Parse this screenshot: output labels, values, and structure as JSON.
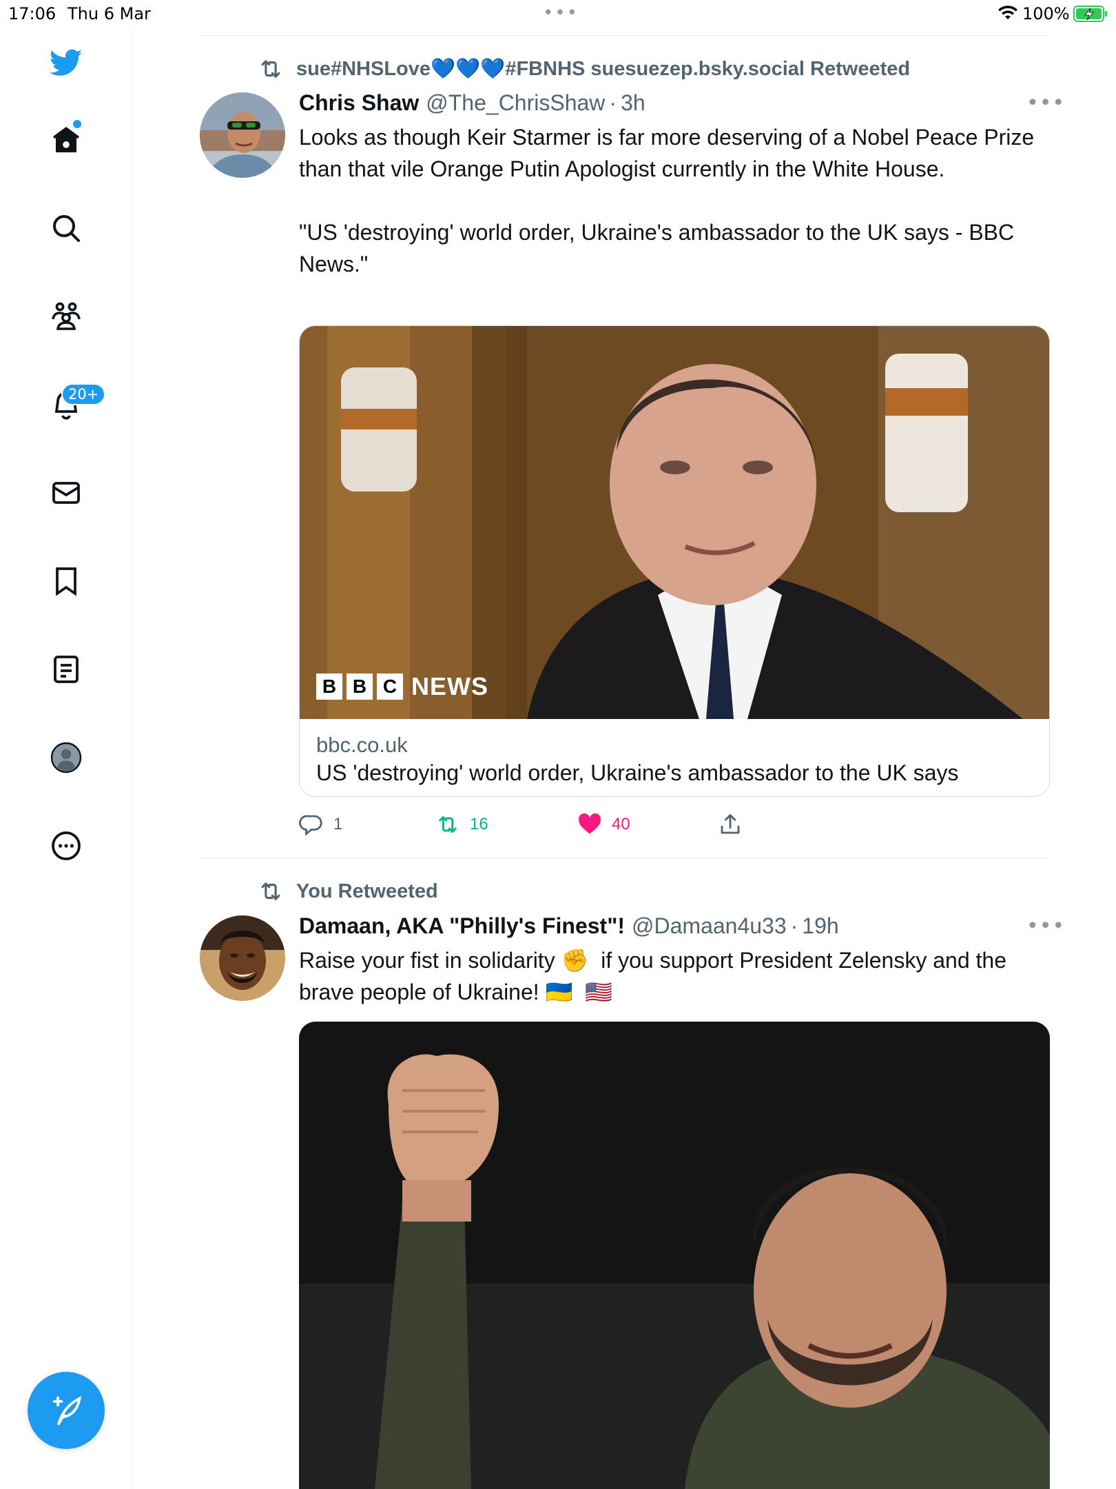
{
  "status_bar": {
    "time": "17:06",
    "date": "Thu 6 Mar",
    "battery": "100%",
    "icons": [
      "wifi-icon",
      "battery-charging-icon"
    ]
  },
  "sidebar": {
    "items": [
      {
        "name": "twitter-logo-icon"
      },
      {
        "name": "home-icon"
      },
      {
        "name": "search-icon"
      },
      {
        "name": "communities-icon"
      },
      {
        "name": "notifications-icon",
        "badge": "20+"
      },
      {
        "name": "messages-icon"
      },
      {
        "name": "bookmarks-icon"
      },
      {
        "name": "lists-icon"
      },
      {
        "name": "profile-icon"
      },
      {
        "name": "more-icon"
      }
    ],
    "compose_icon": "compose-tweet-icon"
  },
  "colors": {
    "accent": "#1d9bf0",
    "retweet_green": "#00ba7c",
    "like_pink": "#f91880",
    "secondary_text": "#536471"
  },
  "tweets": [
    {
      "retweet_context": "sue#NHSLove💙💙💙#FBNHS suesuezep.bsky.social Retweeted",
      "author_name": "Chris Shaw",
      "handle": "@The_ChrisShaw",
      "separator": "·",
      "time": "3h",
      "more": "•••",
      "text": "Looks as though Keir Starmer is far more deserving of a Nobel Peace Prize than that vile Orange Putin Apologist currently in the White House.\n\n\"US 'destroying' world order, Ukraine's ambassador to the UK says - BBC News.\"",
      "card": {
        "logo_letters": [
          "B",
          "B",
          "C"
        ],
        "logo_word": "NEWS",
        "domain": "bbc.co.uk",
        "title": "US 'destroying' world order, Ukraine's ambassador to the UK says"
      },
      "actions": {
        "replies": "1",
        "retweets": "16",
        "likes": "40"
      }
    },
    {
      "retweet_context": "You Retweeted",
      "author_name": "Damaan, AKA \"Philly's Finest\"!",
      "handle": "@Damaan4u33",
      "separator": "·",
      "time": "19h",
      "more": "•••",
      "text": "Raise your fist in solidarity ✊  if you support President Zelensky and the brave people of Ukraine! 🇺🇦  🇺🇸"
    }
  ]
}
